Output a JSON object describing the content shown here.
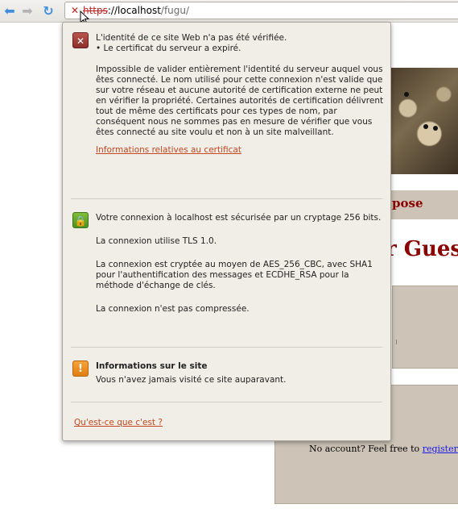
{
  "browser": {
    "url_scheme": "https",
    "url_separator": "://",
    "url_host": "localhost",
    "url_path": "/fugu/"
  },
  "background_page": {
    "nav_fragment": "pose",
    "title_fragment": "r Guest",
    "register_prefix": "No account? Feel free to ",
    "register_link": "register",
    "register_suffix": "!"
  },
  "popup": {
    "identity": {
      "title": "L'identité de ce site Web n'a pas été vérifiée.",
      "bullet": "• Le certificat du serveur a expiré.",
      "description": "Impossible de valider entièrement l'identité du serveur auquel vous êtes connecté. Le nom utilisé pour cette connexion n'est valide que sur votre réseau et aucune autorité de certification externe ne peut en vérifier la propriété. Certaines autorités de certification délivrent tout de même des certificats pour ces types de nom, par conséquent nous ne sommes pas en mesure de vérifier que vous êtes connecté au site voulu et non à un site malveillant.",
      "cert_link": "Informations relatives au certificat"
    },
    "connection": {
      "encryption": "Votre connexion à localhost est sécurisée par un cryptage 256 bits.",
      "protocol": "La connexion utilise TLS 1.0.",
      "cipher": "La connexion est cryptée au moyen de AES_256_CBC, avec SHA1 pour l'authentification des messages et ECDHE_RSA pour la méthode d'échange de clés.",
      "compression": "La connexion n'est pas compressée."
    },
    "site_info": {
      "title": "Informations sur le site",
      "text": "Vous n'avez jamais visité ce site auparavant."
    },
    "help_link": "Qu'est-ce que c'est ?"
  }
}
